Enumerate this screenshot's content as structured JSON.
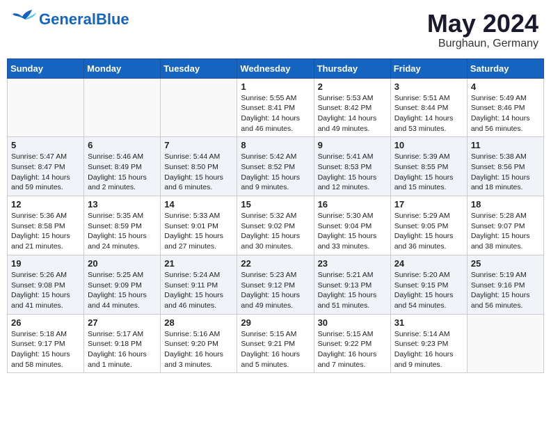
{
  "header": {
    "logo_general": "General",
    "logo_blue": "Blue",
    "title": "May 2024",
    "subtitle": "Burghaun, Germany"
  },
  "weekdays": [
    "Sunday",
    "Monday",
    "Tuesday",
    "Wednesday",
    "Thursday",
    "Friday",
    "Saturday"
  ],
  "weeks": [
    [
      {
        "day": "",
        "info": ""
      },
      {
        "day": "",
        "info": ""
      },
      {
        "day": "",
        "info": ""
      },
      {
        "day": "1",
        "info": "Sunrise: 5:55 AM\nSunset: 8:41 PM\nDaylight: 14 hours\nand 46 minutes."
      },
      {
        "day": "2",
        "info": "Sunrise: 5:53 AM\nSunset: 8:42 PM\nDaylight: 14 hours\nand 49 minutes."
      },
      {
        "day": "3",
        "info": "Sunrise: 5:51 AM\nSunset: 8:44 PM\nDaylight: 14 hours\nand 53 minutes."
      },
      {
        "day": "4",
        "info": "Sunrise: 5:49 AM\nSunset: 8:46 PM\nDaylight: 14 hours\nand 56 minutes."
      }
    ],
    [
      {
        "day": "5",
        "info": "Sunrise: 5:47 AM\nSunset: 8:47 PM\nDaylight: 14 hours\nand 59 minutes."
      },
      {
        "day": "6",
        "info": "Sunrise: 5:46 AM\nSunset: 8:49 PM\nDaylight: 15 hours\nand 2 minutes."
      },
      {
        "day": "7",
        "info": "Sunrise: 5:44 AM\nSunset: 8:50 PM\nDaylight: 15 hours\nand 6 minutes."
      },
      {
        "day": "8",
        "info": "Sunrise: 5:42 AM\nSunset: 8:52 PM\nDaylight: 15 hours\nand 9 minutes."
      },
      {
        "day": "9",
        "info": "Sunrise: 5:41 AM\nSunset: 8:53 PM\nDaylight: 15 hours\nand 12 minutes."
      },
      {
        "day": "10",
        "info": "Sunrise: 5:39 AM\nSunset: 8:55 PM\nDaylight: 15 hours\nand 15 minutes."
      },
      {
        "day": "11",
        "info": "Sunrise: 5:38 AM\nSunset: 8:56 PM\nDaylight: 15 hours\nand 18 minutes."
      }
    ],
    [
      {
        "day": "12",
        "info": "Sunrise: 5:36 AM\nSunset: 8:58 PM\nDaylight: 15 hours\nand 21 minutes."
      },
      {
        "day": "13",
        "info": "Sunrise: 5:35 AM\nSunset: 8:59 PM\nDaylight: 15 hours\nand 24 minutes."
      },
      {
        "day": "14",
        "info": "Sunrise: 5:33 AM\nSunset: 9:01 PM\nDaylight: 15 hours\nand 27 minutes."
      },
      {
        "day": "15",
        "info": "Sunrise: 5:32 AM\nSunset: 9:02 PM\nDaylight: 15 hours\nand 30 minutes."
      },
      {
        "day": "16",
        "info": "Sunrise: 5:30 AM\nSunset: 9:04 PM\nDaylight: 15 hours\nand 33 minutes."
      },
      {
        "day": "17",
        "info": "Sunrise: 5:29 AM\nSunset: 9:05 PM\nDaylight: 15 hours\nand 36 minutes."
      },
      {
        "day": "18",
        "info": "Sunrise: 5:28 AM\nSunset: 9:07 PM\nDaylight: 15 hours\nand 38 minutes."
      }
    ],
    [
      {
        "day": "19",
        "info": "Sunrise: 5:26 AM\nSunset: 9:08 PM\nDaylight: 15 hours\nand 41 minutes."
      },
      {
        "day": "20",
        "info": "Sunrise: 5:25 AM\nSunset: 9:09 PM\nDaylight: 15 hours\nand 44 minutes."
      },
      {
        "day": "21",
        "info": "Sunrise: 5:24 AM\nSunset: 9:11 PM\nDaylight: 15 hours\nand 46 minutes."
      },
      {
        "day": "22",
        "info": "Sunrise: 5:23 AM\nSunset: 9:12 PM\nDaylight: 15 hours\nand 49 minutes."
      },
      {
        "day": "23",
        "info": "Sunrise: 5:21 AM\nSunset: 9:13 PM\nDaylight: 15 hours\nand 51 minutes."
      },
      {
        "day": "24",
        "info": "Sunrise: 5:20 AM\nSunset: 9:15 PM\nDaylight: 15 hours\nand 54 minutes."
      },
      {
        "day": "25",
        "info": "Sunrise: 5:19 AM\nSunset: 9:16 PM\nDaylight: 15 hours\nand 56 minutes."
      }
    ],
    [
      {
        "day": "26",
        "info": "Sunrise: 5:18 AM\nSunset: 9:17 PM\nDaylight: 15 hours\nand 58 minutes."
      },
      {
        "day": "27",
        "info": "Sunrise: 5:17 AM\nSunset: 9:18 PM\nDaylight: 16 hours\nand 1 minute."
      },
      {
        "day": "28",
        "info": "Sunrise: 5:16 AM\nSunset: 9:20 PM\nDaylight: 16 hours\nand 3 minutes."
      },
      {
        "day": "29",
        "info": "Sunrise: 5:15 AM\nSunset: 9:21 PM\nDaylight: 16 hours\nand 5 minutes."
      },
      {
        "day": "30",
        "info": "Sunrise: 5:15 AM\nSunset: 9:22 PM\nDaylight: 16 hours\nand 7 minutes."
      },
      {
        "day": "31",
        "info": "Sunrise: 5:14 AM\nSunset: 9:23 PM\nDaylight: 16 hours\nand 9 minutes."
      },
      {
        "day": "",
        "info": ""
      }
    ]
  ]
}
